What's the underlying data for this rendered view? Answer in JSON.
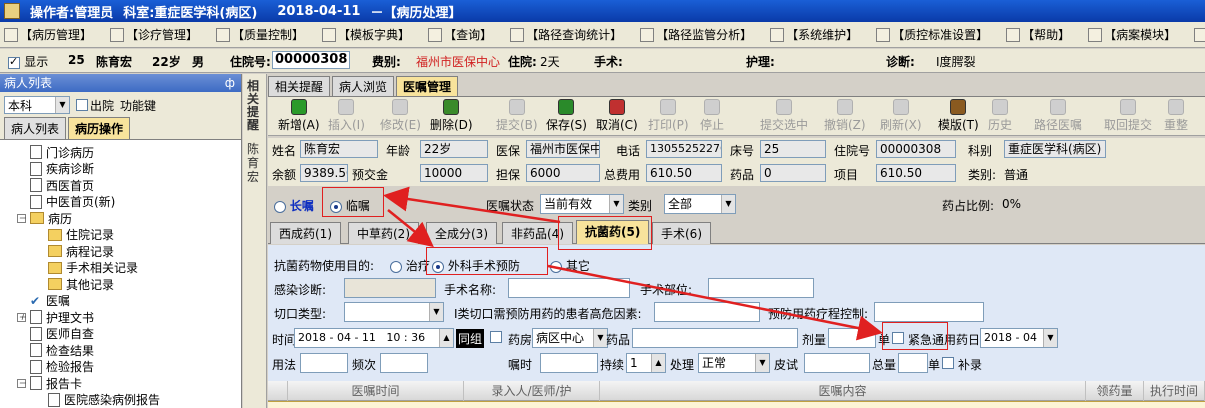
{
  "titlebar": {
    "operator_label": "操作者:",
    "operator": "管理员",
    "dept_label": "科室:",
    "dept": "重症医学科(病区)",
    "date": "2018-04-11",
    "section": "－【病历处理】"
  },
  "menu": [
    "【病历管理】",
    "【诊疗管理】",
    "【质量控制】",
    "【模板字典】",
    "【查询】",
    "【路径查询统计】",
    "【路径监管分析】",
    "【系统维护】",
    "【质控标准设置】",
    "【帮助】",
    "【病案模块】",
    "【窗口】"
  ],
  "patient_bar": {
    "show_label": "显示",
    "bed": "25",
    "name": "陈育宏",
    "age": "22岁",
    "sex": "男",
    "admno_label": "住院号:",
    "admno": "00000308",
    "fee_label": "费别:",
    "fee": "福州市医保中心",
    "stay_label": "住院:",
    "stay": "2天",
    "surgery_label": "手术:",
    "nursing_label": "护理:",
    "diag_label": "诊断:",
    "diag": "Ⅰ度腭裂"
  },
  "left_panel": {
    "title": "病人列表",
    "pin": "ф",
    "dept_select": "本科",
    "discharged_label": "出院",
    "function_label": "功能键",
    "tabs": [
      "病人列表",
      "病历操作"
    ],
    "tree": [
      {
        "label": "门诊病历",
        "level": 1,
        "kind": "doc"
      },
      {
        "label": "疾病诊断",
        "level": 1,
        "kind": "doc"
      },
      {
        "label": "西医首页",
        "level": 1,
        "kind": "doc"
      },
      {
        "label": "中医首页(新)",
        "level": 1,
        "kind": "doc"
      },
      {
        "label": "病历",
        "level": 0,
        "kind": "folder",
        "exp": "－"
      },
      {
        "label": "住院记录",
        "level": 2,
        "kind": "folder"
      },
      {
        "label": "病程记录",
        "level": 2,
        "kind": "folder"
      },
      {
        "label": "手术相关记录",
        "level": 2,
        "kind": "folder"
      },
      {
        "label": "其他记录",
        "level": 2,
        "kind": "folder"
      },
      {
        "label": "医嘱",
        "level": 1,
        "kind": "check"
      },
      {
        "label": "护理文书",
        "level": 0,
        "kind": "doc",
        "exp": "＋"
      },
      {
        "label": "医师自查",
        "level": 1,
        "kind": "doc"
      },
      {
        "label": "检查结果",
        "level": 1,
        "kind": "doc"
      },
      {
        "label": "检验报告",
        "level": 1,
        "kind": "doc"
      },
      {
        "label": "报告卡",
        "level": 0,
        "kind": "doc",
        "exp": "－"
      },
      {
        "label": "医院感染病例报告",
        "level": 2,
        "kind": "doc"
      }
    ]
  },
  "side_labels": {
    "top": "相关提醒",
    "bottom": "陈育宏"
  },
  "main_tabs": [
    "相关提醒",
    "病人浏览",
    "医嘱管理"
  ],
  "toolbar": [
    {
      "label": "新增(A)",
      "dis": false,
      "color": "#2a9a2a"
    },
    {
      "label": "插入(I)",
      "dis": true
    },
    {
      "label": "修改(E)",
      "dis": true
    },
    {
      "label": "删除(D)",
      "dis": false,
      "color": "#3a8a2a"
    },
    {
      "label": "提交(B)",
      "dis": true
    },
    {
      "label": "保存(S)",
      "dis": false,
      "color": "#2a8a2a"
    },
    {
      "label": "取消(C)",
      "dis": false,
      "color": "#c03030"
    },
    {
      "label": "打印(P)",
      "dis": true
    },
    {
      "label": "停止",
      "dis": true
    },
    {
      "label": "提交选中",
      "dis": true
    },
    {
      "label": "撤销(Z)",
      "dis": true
    },
    {
      "label": "刷新(X)",
      "dis": true
    },
    {
      "label": "模版(T)",
      "dis": false,
      "color": "#8a5a20"
    },
    {
      "label": "历史",
      "dis": true
    },
    {
      "label": "路径医嘱",
      "dis": true
    },
    {
      "label": "取回提交",
      "dis": true
    },
    {
      "label": "重整",
      "dis": true
    }
  ],
  "patient_grid": {
    "name_label": "姓名",
    "name": "陈育宏",
    "age_label": "年龄",
    "age": "22岁",
    "ins_label": "医保",
    "ins": "福州市医保中",
    "phone_label": "电话",
    "phone": "13055252276",
    "bed_label": "床号",
    "bed": "25",
    "admno_label": "住院号",
    "admno": "00000308",
    "dept_label": "科别",
    "dept": "重症医学科(病区)",
    "balance_label": "余额",
    "balance": "9389.50",
    "prepay_label": "预交金",
    "prepay": "10000",
    "guar_label": "担保",
    "guar": "6000",
    "total_label": "总费用",
    "total": "610.50",
    "drug_label": "药品",
    "drug": "0",
    "item_label": "项目",
    "item": "610.50",
    "type_label": "类别:",
    "type": "普通"
  },
  "order_row": {
    "long_label": "长嘱",
    "temp_label": "临嘱",
    "status_label": "医嘱状态",
    "status": "当前有效",
    "cat_label": "类别",
    "cat": "全部",
    "ratio_label": "药占比例:",
    "ratio": "0%"
  },
  "drug_tabs": [
    "西成药(1)",
    "中草药(2)",
    "全成分(3)",
    "非药品(4)",
    "抗菌药(5)",
    "手术(6)"
  ],
  "form": {
    "purpose_label": "抗菌药物使用目的:",
    "p1": "治疗",
    "p2": "外科手术预防",
    "p3": "其它",
    "infect_label": "感染诊断:",
    "surgname_label": "手术名称:",
    "surgsite_label": "手术部位:",
    "incision_label": "切口类型:",
    "risk_label": "Ⅰ类切口需预防用药的患者高危因素:",
    "course_label": "预防用药疗程控制:",
    "time_label": "时间",
    "time": "2018 - 04 - 11   10 : 36",
    "group_label": "同组",
    "pharm_label": "药房",
    "pharm": "病区中心",
    "drug_label": "药品",
    "dose_label": "剂量",
    "unit_label": "单",
    "urgent_label": "紧急通用",
    "days_label": "药日",
    "days": "2018 - 04",
    "usage_label": "用法",
    "freq_label": "频次",
    "drip_label": "嘱时",
    "dur_label": "持续",
    "dur": "1",
    "proc_label": "处理",
    "proc": "正常",
    "skin_label": "皮试",
    "totalqty_label": "总量",
    "unit2_label": "单",
    "supp_label": "补录"
  },
  "grid_headers": [
    "医嘱时间",
    "录入人/医师/护",
    "医嘱内容",
    "领药量",
    "执行时间"
  ]
}
